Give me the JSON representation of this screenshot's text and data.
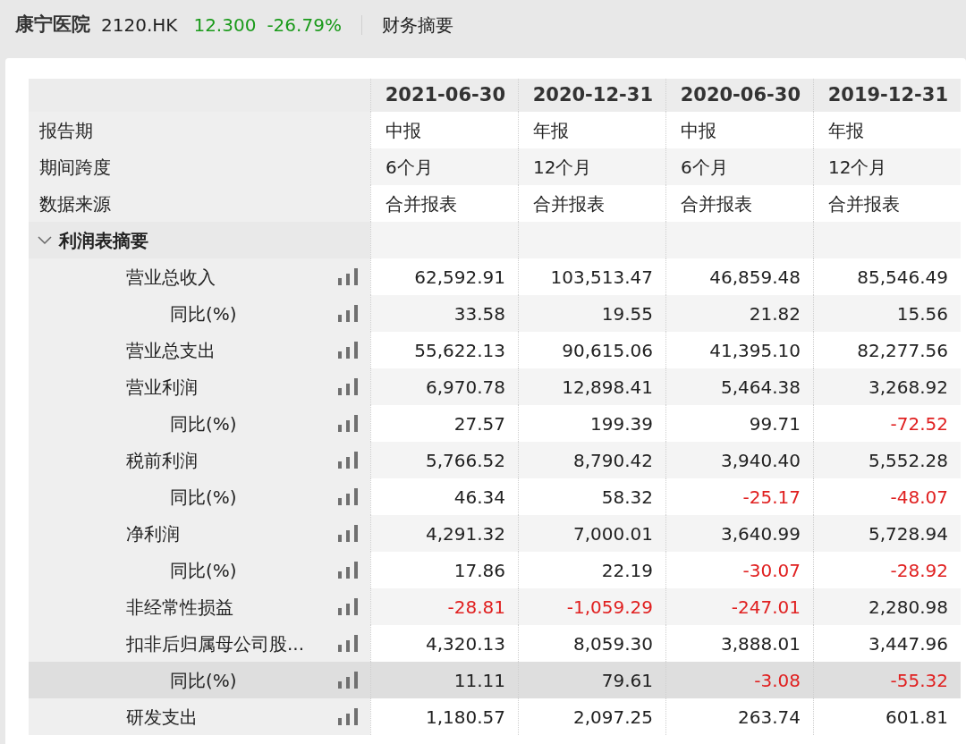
{
  "header": {
    "name": "康宁医院",
    "code": "2120.HK",
    "price": "12.300",
    "change": "-26.79%",
    "page": "财务摘要"
  },
  "columns": [
    "2021-06-30",
    "2020-12-31",
    "2020-06-30",
    "2019-12-31"
  ],
  "info_rows": [
    {
      "label": "报告期",
      "values": [
        "中报",
        "年报",
        "中报",
        "年报"
      ]
    },
    {
      "label": "期间跨度",
      "values": [
        "6个月",
        "12个月",
        "6个月",
        "12个月"
      ]
    },
    {
      "label": "数据来源",
      "values": [
        "合并报表",
        "合并报表",
        "合并报表",
        "合并报表"
      ]
    }
  ],
  "section": {
    "label": "利润表摘要",
    "expanded": true,
    "rows": [
      {
        "label": "营业总收入",
        "selected": false,
        "values": [
          {
            "text": "62,592.91",
            "negative": false
          },
          {
            "text": "103,513.47",
            "negative": false
          },
          {
            "text": "46,859.48",
            "negative": false
          },
          {
            "text": "85,546.49",
            "negative": false
          }
        ],
        "children": [
          {
            "label": "同比(%)",
            "selected": false,
            "values": [
              {
                "text": "33.58",
                "negative": false
              },
              {
                "text": "19.55",
                "negative": false
              },
              {
                "text": "21.82",
                "negative": false
              },
              {
                "text": "15.56",
                "negative": false
              }
            ]
          }
        ]
      },
      {
        "label": "营业总支出",
        "selected": false,
        "values": [
          {
            "text": "55,622.13",
            "negative": false
          },
          {
            "text": "90,615.06",
            "negative": false
          },
          {
            "text": "41,395.10",
            "negative": false
          },
          {
            "text": "82,277.56",
            "negative": false
          }
        ]
      },
      {
        "label": "营业利润",
        "selected": false,
        "values": [
          {
            "text": "6,970.78",
            "negative": false
          },
          {
            "text": "12,898.41",
            "negative": false
          },
          {
            "text": "5,464.38",
            "negative": false
          },
          {
            "text": "3,268.92",
            "negative": false
          }
        ],
        "children": [
          {
            "label": "同比(%)",
            "selected": false,
            "values": [
              {
                "text": "27.57",
                "negative": false
              },
              {
                "text": "199.39",
                "negative": false
              },
              {
                "text": "99.71",
                "negative": false
              },
              {
                "text": "-72.52",
                "negative": true
              }
            ]
          }
        ]
      },
      {
        "label": "税前利润",
        "selected": false,
        "values": [
          {
            "text": "5,766.52",
            "negative": false
          },
          {
            "text": "8,790.42",
            "negative": false
          },
          {
            "text": "3,940.40",
            "negative": false
          },
          {
            "text": "5,552.28",
            "negative": false
          }
        ],
        "children": [
          {
            "label": "同比(%)",
            "selected": false,
            "values": [
              {
                "text": "46.34",
                "negative": false
              },
              {
                "text": "58.32",
                "negative": false
              },
              {
                "text": "-25.17",
                "negative": true
              },
              {
                "text": "-48.07",
                "negative": true
              }
            ]
          }
        ]
      },
      {
        "label": "净利润",
        "selected": false,
        "values": [
          {
            "text": "4,291.32",
            "negative": false
          },
          {
            "text": "7,000.01",
            "negative": false
          },
          {
            "text": "3,640.99",
            "negative": false
          },
          {
            "text": "5,728.94",
            "negative": false
          }
        ],
        "children": [
          {
            "label": "同比(%)",
            "selected": false,
            "values": [
              {
                "text": "17.86",
                "negative": false
              },
              {
                "text": "22.19",
                "negative": false
              },
              {
                "text": "-30.07",
                "negative": true
              },
              {
                "text": "-28.92",
                "negative": true
              }
            ]
          }
        ]
      },
      {
        "label": "非经常性损益",
        "selected": false,
        "values": [
          {
            "text": "-28.81",
            "negative": true
          },
          {
            "text": "-1,059.29",
            "negative": true
          },
          {
            "text": "-247.01",
            "negative": true
          },
          {
            "text": "2,280.98",
            "negative": false
          }
        ]
      },
      {
        "label": "扣非后归属母公司股...",
        "selected": false,
        "values": [
          {
            "text": "4,320.13",
            "negative": false
          },
          {
            "text": "8,059.30",
            "negative": false
          },
          {
            "text": "3,888.01",
            "negative": false
          },
          {
            "text": "3,447.96",
            "negative": false
          }
        ],
        "children": [
          {
            "label": "同比(%)",
            "selected": true,
            "values": [
              {
                "text": "11.11",
                "negative": false
              },
              {
                "text": "79.61",
                "negative": false
              },
              {
                "text": "-3.08",
                "negative": true
              },
              {
                "text": "-55.32",
                "negative": true
              }
            ]
          }
        ]
      },
      {
        "label": "研发支出",
        "selected": false,
        "values": [
          {
            "text": "1,180.57",
            "negative": false
          },
          {
            "text": "2,097.25",
            "negative": false
          },
          {
            "text": "263.74",
            "negative": false
          },
          {
            "text": "601.81",
            "negative": false
          }
        ]
      }
    ]
  }
}
